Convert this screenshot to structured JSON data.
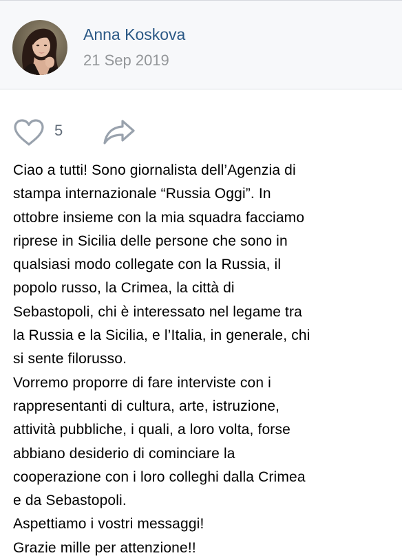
{
  "author": {
    "name": "Anna Koskova",
    "date": "21 Sep 2019"
  },
  "actions": {
    "like_icon": "heart-outline-icon",
    "like_count": "5",
    "share_icon": "share-arrow-icon"
  },
  "colors": {
    "author_name": "#2a5885",
    "date": "#939699",
    "icon": "#99a2ad",
    "header_bg": "#f7f8fa"
  },
  "post": {
    "lines": [
      "Ciao a tutti! Sono giornalista dell’Agenzia di",
      "stampa internazionale “Russia Oggi”. In",
      "ottobre insieme con la mia squadra facciamo",
      "riprese in Sicilia delle persone che sono in",
      "qualsiasi modo collegate con la Russia, il",
      "popolo russo, la Crimea, la città di",
      "Sebastopoli, chi è interessato nel legame tra",
      "la Russia e la Sicilia, e l’Italia, in generale, chi",
      "si sente filorusso.",
      "Vorremo proporre di fare interviste con i",
      "rappresentanti di cultura, arte, istruzione,",
      "attività pubbliche, i quali, a loro volta, forse",
      "abbiano desiderio di cominciare la",
      "cooperazione con i loro colleghi dalla Crimea",
      "e da Sebastopoli.",
      "Aspettiamo i vostri messaggi!",
      "Grazie mille per attenzione!!"
    ]
  }
}
